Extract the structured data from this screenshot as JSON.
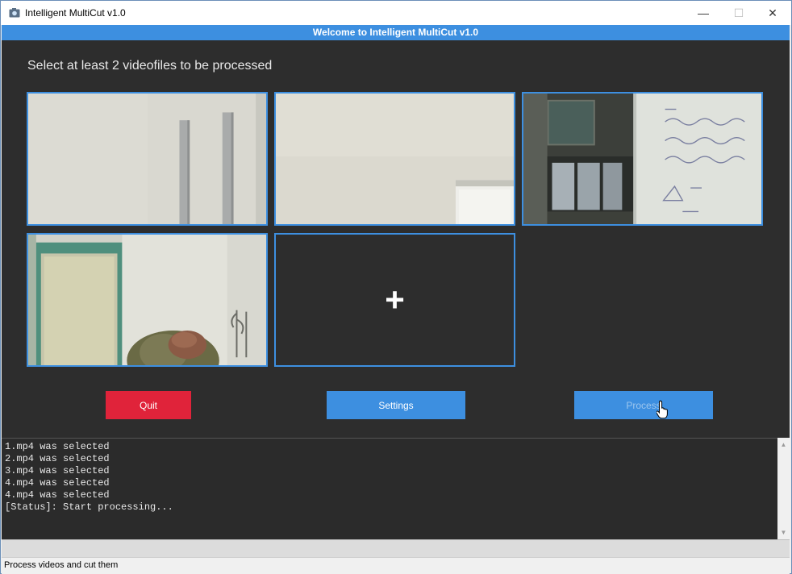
{
  "window": {
    "title": "Intelligent MultiCut v1.0",
    "minimize": "—",
    "maximize": "☐",
    "close": "✕"
  },
  "banner": {
    "text": "Welcome to Intelligent MultiCut v1.0"
  },
  "main": {
    "instruction": "Select at least 2 videofiles to be processed",
    "add_tile": {
      "symbol": "+"
    }
  },
  "buttons": {
    "quit": "Quit",
    "settings": "Settings",
    "process": "Process"
  },
  "log": {
    "lines": [
      "1.mp4 was selected",
      "2.mp4 was selected",
      "3.mp4 was selected",
      "4.mp4 was selected",
      "4.mp4 was selected",
      "[Status]: Start processing..."
    ]
  },
  "status": {
    "text": "Process videos and cut them"
  },
  "colors": {
    "accent": "#3d8fe0",
    "danger": "#e0233a",
    "panel": "#2d2d2d"
  }
}
